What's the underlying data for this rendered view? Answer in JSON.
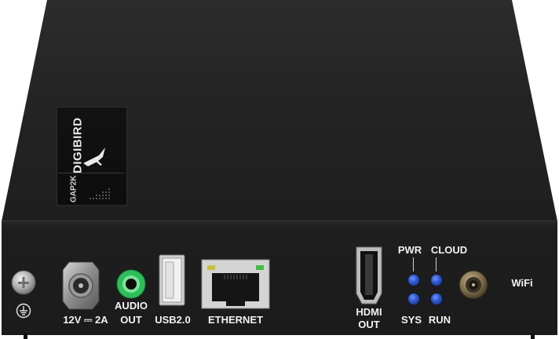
{
  "device": {
    "brand": "DIGIBIRD",
    "model": "GAP2K"
  },
  "ports": {
    "power_label": "12V ⎓ 2A",
    "audio_label_line1": "AUDIO",
    "audio_label_line2": "OUT",
    "usb_label": "USB2.0",
    "ethernet_label": "ETHERNET",
    "hdmi_label_line1": "HDMI",
    "hdmi_label_line2": "OUT",
    "wifi_label": "WiFi"
  },
  "leds": {
    "pwr": "PWR",
    "cloud": "CLOUD",
    "sys": "SYS",
    "run": "RUN",
    "color": "#2b55c9"
  },
  "colors": {
    "chassis": "#1e1e1e",
    "audio_jack": "#2fbf5a",
    "usb_body": "#d9d9d9",
    "rj45_led_left": "#c9c23a",
    "rj45_led_right": "#3fbf3f"
  }
}
